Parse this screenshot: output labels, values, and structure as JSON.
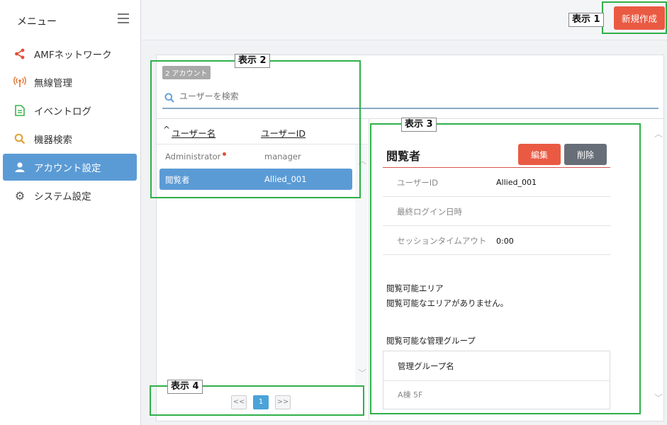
{
  "sidebar": {
    "title": "メニュー",
    "items": [
      {
        "label": "AMFネットワーク",
        "icon": "share-icon",
        "color": "#e0503c"
      },
      {
        "label": "無線管理",
        "icon": "antenna-icon",
        "color": "#e07a3c"
      },
      {
        "label": "イベントログ",
        "icon": "document-icon",
        "color": "#3cb34a"
      },
      {
        "label": "機器検索",
        "icon": "search-icon",
        "color": "#e0a030"
      },
      {
        "label": "アカウント設定",
        "icon": "user-icon",
        "color": "#ffffff"
      },
      {
        "label": "システム設定",
        "icon": "gear-icon",
        "color": "#555555"
      }
    ],
    "active_index": 4
  },
  "toolbar": {
    "new_label": "新規作成"
  },
  "list": {
    "count_badge": "2 アカウント",
    "search_placeholder": "ユーザーを検索",
    "sort_indicator": "^",
    "col_username": "ユーザー名",
    "col_userid": "ユーザーID",
    "rows": [
      {
        "name": "Administrator",
        "id": "manager"
      },
      {
        "name": "閲覧者",
        "id": "Allied_001"
      }
    ],
    "selected_index": 1
  },
  "pager": {
    "prev": "<<",
    "current": "1",
    "next": ">>"
  },
  "detail": {
    "title": "閲覧者",
    "edit_label": "編集",
    "delete_label": "削除",
    "fields": [
      {
        "label": "ユーザーID",
        "value": "Allied_001"
      },
      {
        "label": "最終ログイン日時",
        "value": ""
      },
      {
        "label": "セッションタイムアウト",
        "value": "0:00"
      }
    ],
    "area_heading": "閲覧可能エリア",
    "area_value": "閲覧可能なエリアがありません。",
    "group_heading": "閲覧可能な管理グループ",
    "group_column": "管理グループ名",
    "group_rows": [
      "A棟 5F"
    ]
  },
  "annotations": [
    "表示 1",
    "表示 2",
    "表示 3",
    "表示 4"
  ],
  "colors": {
    "accent": "#5b9bd5",
    "danger": "#ea5a43",
    "highlight": "#2fb04a"
  }
}
